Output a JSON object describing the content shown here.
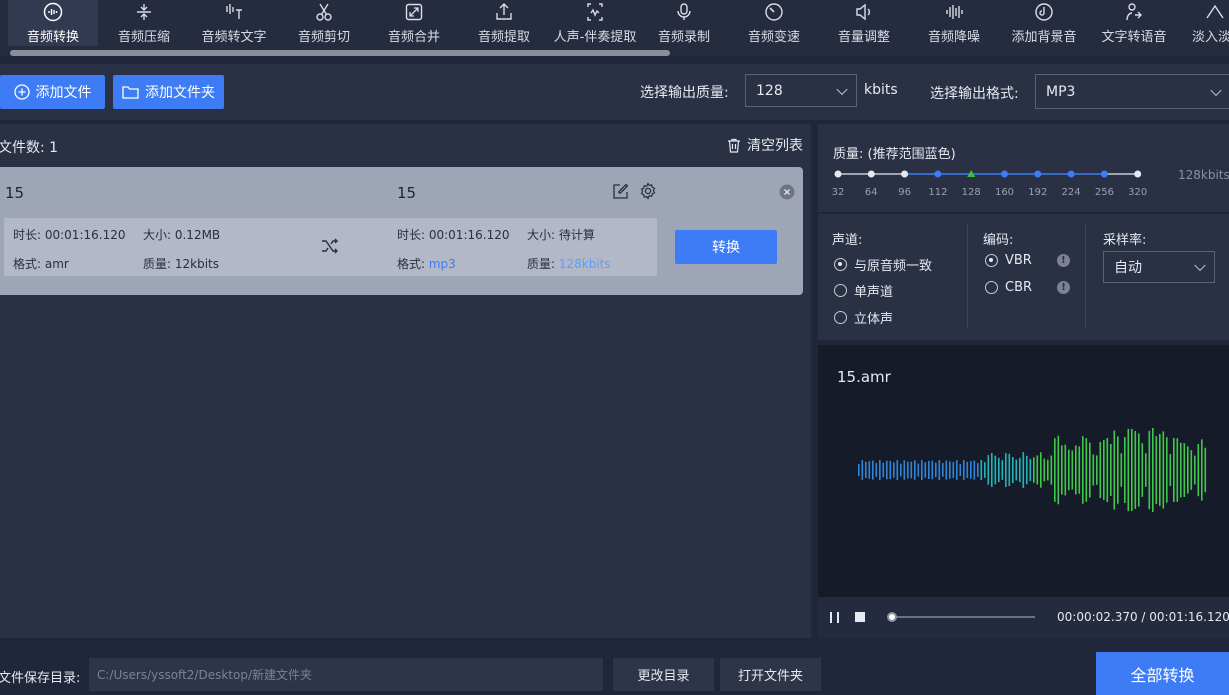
{
  "toolbar": {
    "items": [
      {
        "label": "音频转换",
        "icon": "audio-convert-icon"
      },
      {
        "label": "音频压缩",
        "icon": "compress-icon"
      },
      {
        "label": "音频转文字",
        "icon": "speech-to-text-icon"
      },
      {
        "label": "音频剪切",
        "icon": "scissors-icon"
      },
      {
        "label": "音频合并",
        "icon": "merge-icon"
      },
      {
        "label": "音频提取",
        "icon": "extract-icon"
      },
      {
        "label": "人声-伴奏提取",
        "icon": "vocal-separate-icon"
      },
      {
        "label": "音频录制",
        "icon": "microphone-icon"
      },
      {
        "label": "音频变速",
        "icon": "speedometer-icon"
      },
      {
        "label": "音量调整",
        "icon": "volume-icon"
      },
      {
        "label": "音频降噪",
        "icon": "denoise-icon"
      },
      {
        "label": "添加背景音",
        "icon": "music-disc-icon"
      },
      {
        "label": "文字转语音",
        "icon": "text-to-speech-icon"
      },
      {
        "label": "淡入淡",
        "icon": "fade-icon"
      }
    ],
    "active_index": 0
  },
  "actions": {
    "add_file": "添加文件",
    "add_folder": "添加文件夹",
    "quality_label": "选择输出质量:",
    "quality_value": "128",
    "quality_unit": "kbits",
    "format_label": "选择输出格式:",
    "format_value": "MP3"
  },
  "filelist": {
    "count_label": "文件数: 1",
    "clear_label": "清空列表",
    "file": {
      "source_name": "15",
      "target_name": "15",
      "source_duration": "时长: 00:01:16.120",
      "source_size": "大小: 0.12MB",
      "source_format_label": "格式: ",
      "source_format": "amr",
      "source_quality": "质量: 12kbits",
      "target_duration": "时长: 00:01:16.120",
      "target_size": "大小: 待计算",
      "target_format_label": "格式: ",
      "target_format": "mp3",
      "target_quality_label": "质量: ",
      "target_quality": "128kbits",
      "convert_label": "转换"
    }
  },
  "quality": {
    "title": "质量: (推荐范围蓝色)",
    "ticks": [
      "32",
      "64",
      "96",
      "112",
      "128",
      "160",
      "192",
      "224",
      "256",
      "320"
    ],
    "selected": "128",
    "readout": "128kbits",
    "colors": {
      "recommended": "#3d7cf5",
      "normal": "#e6e9f0",
      "selected": "#3cc13b"
    }
  },
  "settings": {
    "channel_title": "声道:",
    "channel_options": [
      "与原音频一致",
      "单声道",
      "立体声"
    ],
    "channel_selected": 0,
    "encoding_title": "编码:",
    "encoding_options": [
      "VBR",
      "CBR"
    ],
    "encoding_selected": 0,
    "samplerate_title": "采样率:",
    "samplerate_value": "自动"
  },
  "player": {
    "filename": "15.amr",
    "time": "00:00:02.370 / 00:01:16.120",
    "progress": 0.03,
    "wave_colors": [
      "#2f86d8",
      "#22b4b8",
      "#3fc94a"
    ]
  },
  "bottom": {
    "save_label": "文件保存目录:",
    "save_path": "C:/Users/yssoft2/Desktop/新建文件夹",
    "change_dir": "更改目录",
    "open_folder": "打开文件夹",
    "convert_all": "全部转换"
  }
}
